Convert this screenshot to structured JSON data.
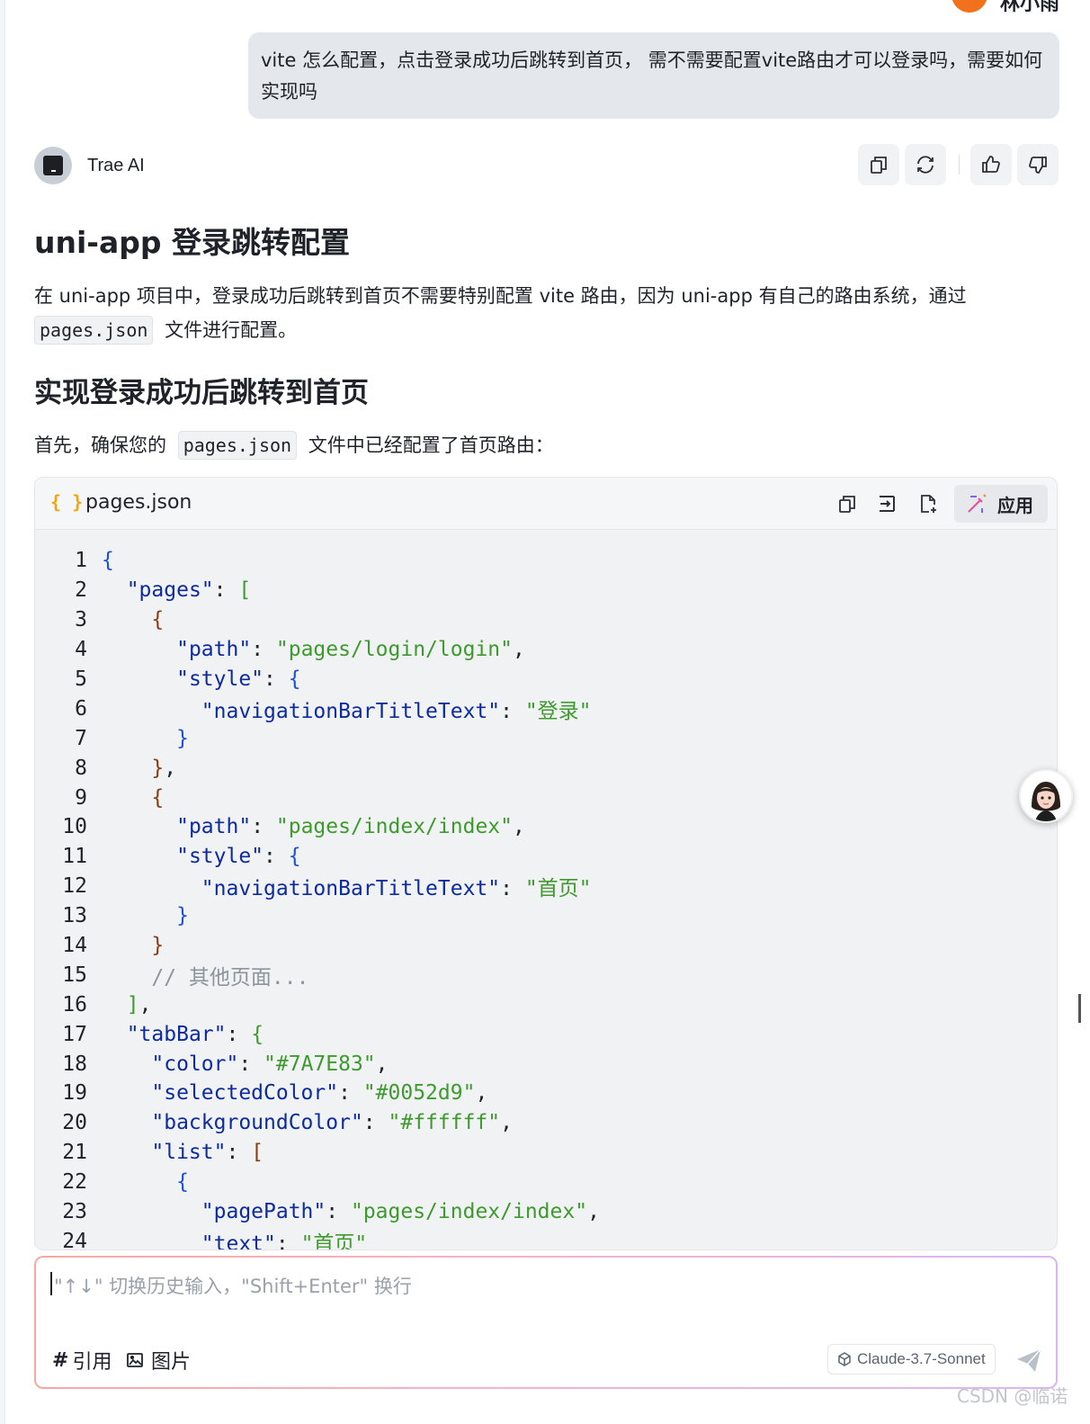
{
  "user": {
    "name": "林小雨",
    "message": "vite 怎么配置，点击登录成功后跳转到首页， 需不需要配置vite路由才可以登录吗，需要如何实现吗"
  },
  "assistant": {
    "name": "Trae AI",
    "actions": [
      "copy-icon",
      "refresh-icon",
      "thumbs-up-icon",
      "thumbs-down-icon"
    ]
  },
  "content": {
    "heading1": "uni-app 登录跳转配置",
    "para1_before": "在 uni-app 项目中，登录成功后跳转到首页不需要特别配置 vite 路由，因为 uni-app 有自己的路由系统，通过",
    "para1_code": "pages.json",
    "para1_after": "文件进行配置。",
    "heading2": "实现登录成功后跳转到首页",
    "para2_before": "首先，确保您的",
    "para2_code": "pages.json",
    "para2_after": "文件中已经配置了首页路由："
  },
  "code_block": {
    "file_icon": "{ }",
    "file_name": "pages.json",
    "apply_label": "应用",
    "lines": [
      [
        [
          "br1",
          "{"
        ]
      ],
      [
        [
          "pun",
          "  "
        ],
        [
          "key",
          "\"pages\""
        ],
        [
          "pun",
          ": "
        ],
        [
          "br2",
          "["
        ]
      ],
      [
        [
          "pun",
          "    "
        ],
        [
          "br3",
          "{"
        ]
      ],
      [
        [
          "pun",
          "      "
        ],
        [
          "key",
          "\"path\""
        ],
        [
          "pun",
          ": "
        ],
        [
          "str",
          "\"pages/login/login\""
        ],
        [
          "pun",
          ","
        ]
      ],
      [
        [
          "pun",
          "      "
        ],
        [
          "key",
          "\"style\""
        ],
        [
          "pun",
          ": "
        ],
        [
          "br1",
          "{"
        ]
      ],
      [
        [
          "pun",
          "        "
        ],
        [
          "key",
          "\"navigationBarTitleText\""
        ],
        [
          "pun",
          ": "
        ],
        [
          "str",
          "\"登录\""
        ]
      ],
      [
        [
          "pun",
          "      "
        ],
        [
          "br1",
          "}"
        ]
      ],
      [
        [
          "pun",
          "    "
        ],
        [
          "br3",
          "}"
        ],
        [
          "pun",
          ","
        ]
      ],
      [
        [
          "pun",
          "    "
        ],
        [
          "br3",
          "{"
        ]
      ],
      [
        [
          "pun",
          "      "
        ],
        [
          "key",
          "\"path\""
        ],
        [
          "pun",
          ": "
        ],
        [
          "str",
          "\"pages/index/index\""
        ],
        [
          "pun",
          ","
        ]
      ],
      [
        [
          "pun",
          "      "
        ],
        [
          "key",
          "\"style\""
        ],
        [
          "pun",
          ": "
        ],
        [
          "br1",
          "{"
        ]
      ],
      [
        [
          "pun",
          "        "
        ],
        [
          "key",
          "\"navigationBarTitleText\""
        ],
        [
          "pun",
          ": "
        ],
        [
          "str",
          "\"首页\""
        ]
      ],
      [
        [
          "pun",
          "      "
        ],
        [
          "br1",
          "}"
        ]
      ],
      [
        [
          "pun",
          "    "
        ],
        [
          "br3",
          "}"
        ]
      ],
      [
        [
          "pun",
          "    "
        ],
        [
          "com",
          "// 其他页面..."
        ]
      ],
      [
        [
          "pun",
          "  "
        ],
        [
          "br2",
          "]"
        ],
        [
          "pun",
          ","
        ]
      ],
      [
        [
          "pun",
          "  "
        ],
        [
          "key",
          "\"tabBar\""
        ],
        [
          "pun",
          ": "
        ],
        [
          "br2",
          "{"
        ]
      ],
      [
        [
          "pun",
          "    "
        ],
        [
          "key",
          "\"color\""
        ],
        [
          "pun",
          ": "
        ],
        [
          "str",
          "\"#7A7E83\""
        ],
        [
          "pun",
          ","
        ]
      ],
      [
        [
          "pun",
          "    "
        ],
        [
          "key",
          "\"selectedColor\""
        ],
        [
          "pun",
          ": "
        ],
        [
          "str",
          "\"#0052d9\""
        ],
        [
          "pun",
          ","
        ]
      ],
      [
        [
          "pun",
          "    "
        ],
        [
          "key",
          "\"backgroundColor\""
        ],
        [
          "pun",
          ": "
        ],
        [
          "str",
          "\"#ffffff\""
        ],
        [
          "pun",
          ","
        ]
      ],
      [
        [
          "pun",
          "    "
        ],
        [
          "key",
          "\"list\""
        ],
        [
          "pun",
          ": "
        ],
        [
          "br3",
          "["
        ]
      ],
      [
        [
          "pun",
          "      "
        ],
        [
          "br1",
          "{"
        ]
      ],
      [
        [
          "pun",
          "        "
        ],
        [
          "key",
          "\"pagePath\""
        ],
        [
          "pun",
          ": "
        ],
        [
          "str",
          "\"pages/index/index\""
        ],
        [
          "pun",
          ","
        ]
      ],
      [
        [
          "pun",
          "        "
        ],
        [
          "key",
          "\"text\""
        ],
        [
          "pun",
          ": "
        ],
        [
          "str",
          "\"首页\""
        ]
      ]
    ]
  },
  "input": {
    "placeholder": "\"↑↓\" 切换历史输入，\"Shift+Enter\" 换行",
    "ref_label": "引用",
    "image_label": "图片",
    "model": "Claude-3.7-Sonnet"
  },
  "watermark": "CSDN @临诺",
  "colors": {
    "user_avatar": "#f2711c",
    "code_key": "#0d2b9e",
    "code_string": "#3e9a2e",
    "code_comment": "#8d949e",
    "json_icon": "#f2a60c"
  }
}
